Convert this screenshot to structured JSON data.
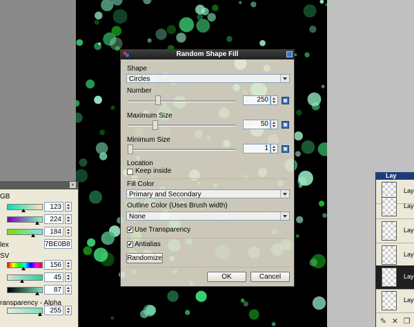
{
  "colors_panel": {
    "rgb_label": "GB",
    "hsv_label": "SV",
    "hex_label": "lex",
    "alpha_label": "ransparency - Alpha",
    "r_value": "123",
    "g_value": "224",
    "b_value": "184",
    "hex_value": "7BE0B8",
    "h_value": "156",
    "s_value": "45",
    "v_value": "87",
    "alpha_value": "255",
    "r_label": "",
    "g_label": "",
    "b_label": "",
    "h_label": "",
    "s_label": "",
    "v_label": ""
  },
  "layers_panel": {
    "title": "Lay",
    "items": [
      "Laye",
      "Laye",
      "Laye",
      "Laye",
      "Laye",
      "Laye"
    ]
  },
  "dialog": {
    "title": "Random Shape Fill",
    "shape_label": "Shape",
    "shape_value": "Circles",
    "number_label": "Number",
    "number_value": "250",
    "number_level": 0.27,
    "max_size_label": "Maximum Size",
    "max_size_value": "50",
    "max_size_level": 0.24,
    "min_size_label": "Minimum Size",
    "min_size_value": "1",
    "min_size_level": 0.0,
    "location_label": "Location",
    "keep_inside_label": "Keep inside",
    "keep_inside_checked": false,
    "fill_color_label": "Fill Color",
    "fill_color_value": "Primary and Secondary",
    "outline_color_label": "Outline Color (Uses Brush width)",
    "outline_color_value": "None",
    "use_transparency_label": "Use Transparency",
    "use_transparency_checked": true,
    "antialias_label": "Antialias",
    "antialias_checked": true,
    "randomize_label": "Randomize",
    "ok_label": "OK",
    "cancel_label": "Cancel",
    "check_mark": "✔"
  },
  "colors": {
    "primary": "#7BE0B8",
    "secondary": "#1ec01e"
  }
}
